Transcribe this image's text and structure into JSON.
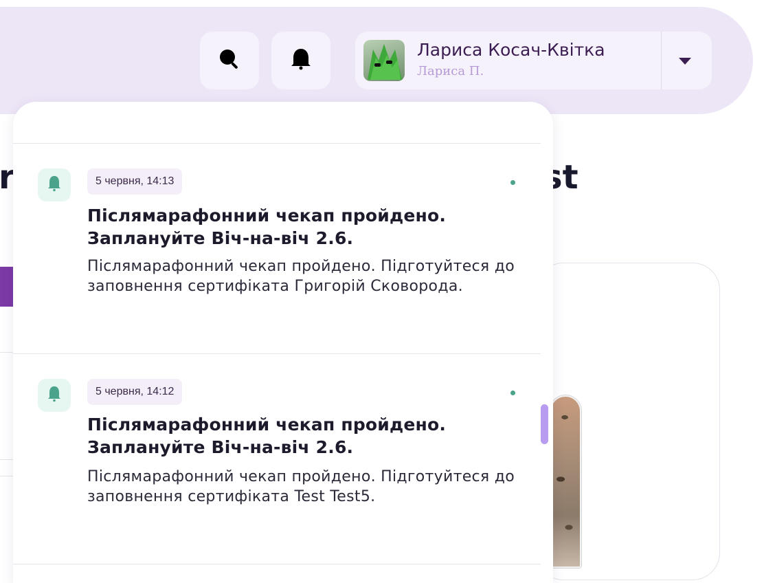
{
  "header": {
    "search_icon": "search-icon",
    "bell_icon": "bell-icon",
    "user": {
      "name": "Лариса Косач-Квітка",
      "short_name": "Лариса П.",
      "avatar": "avatar-image"
    }
  },
  "background": {
    "title_left_fragment": "r",
    "title_right_fragment": "st"
  },
  "notifications": [
    {
      "date": "5 червня, 14:13",
      "title": "Післямарафонний чекап пройдено. Заплануйте Віч-на-віч 2.6.",
      "body": "Післямарафонний чекап пройдено. Підготуйтеся до заповнення сертифіката Григорій Сковорода.",
      "unread": true
    },
    {
      "date": "5 червня, 14:12",
      "title": "Післямарафонний чекап пройдено. Заплануйте Віч-на-віч 2.6.",
      "body": "Післямарафонний чекап пройдено. Підготуйтеся до заповнення сертифіката Test Test5.",
      "unread": true
    }
  ],
  "colors": {
    "header_bg": "#ede6f7",
    "accent_purple": "#7b3aa6",
    "unread_dot": "#4aa38a",
    "scrollbar": "#b89cf0"
  }
}
